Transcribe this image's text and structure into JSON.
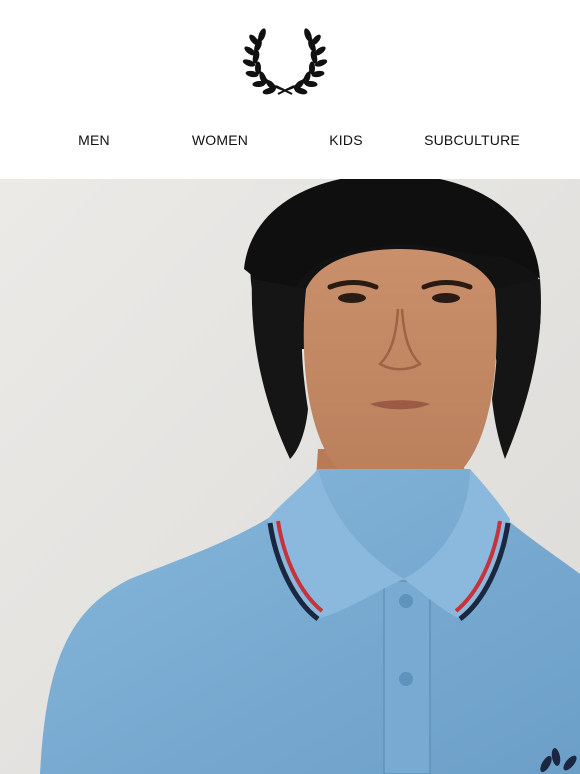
{
  "brand": {
    "logo_icon": "laurel-wreath-icon"
  },
  "nav": {
    "items": [
      {
        "label": "MEN"
      },
      {
        "label": "WOMEN"
      },
      {
        "label": "KIDS"
      },
      {
        "label": "SUBCULTURE"
      }
    ]
  },
  "hero": {
    "image_icon": "hero-model-photo",
    "colors": {
      "background": "#e7e6e3",
      "shirt": "#7fb0d6",
      "tipping_navy": "#1b2740",
      "tipping_red": "#c8323b"
    }
  }
}
